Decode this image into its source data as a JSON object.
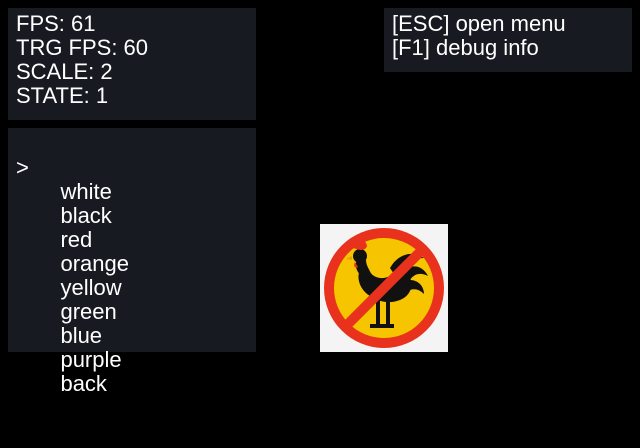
{
  "stats": {
    "fps": "FPS: 61",
    "target_fps": "TRG FPS: 60",
    "scale": "SCALE: 2",
    "state": "STATE: 1"
  },
  "help": {
    "menu_hint": "[ESC] open menu",
    "debug_hint": "[F1] debug info"
  },
  "menu": {
    "cursor": ">",
    "selected_index": 1,
    "items": [
      {
        "label": "white"
      },
      {
        "label": "black"
      },
      {
        "label": "red"
      },
      {
        "label": "orange"
      },
      {
        "label": "yellow"
      },
      {
        "label": "green"
      },
      {
        "label": "blue"
      },
      {
        "label": "purple"
      },
      {
        "label": "back"
      }
    ]
  },
  "colors": {
    "background": "#000000",
    "panel": "#171a21",
    "text": "#ffffff",
    "logo_ring": "#e8321e",
    "logo_fill": "#f7c400",
    "logo_bg": "#f4f4f4"
  },
  "logo": {
    "icon": "no-rooster-icon"
  }
}
